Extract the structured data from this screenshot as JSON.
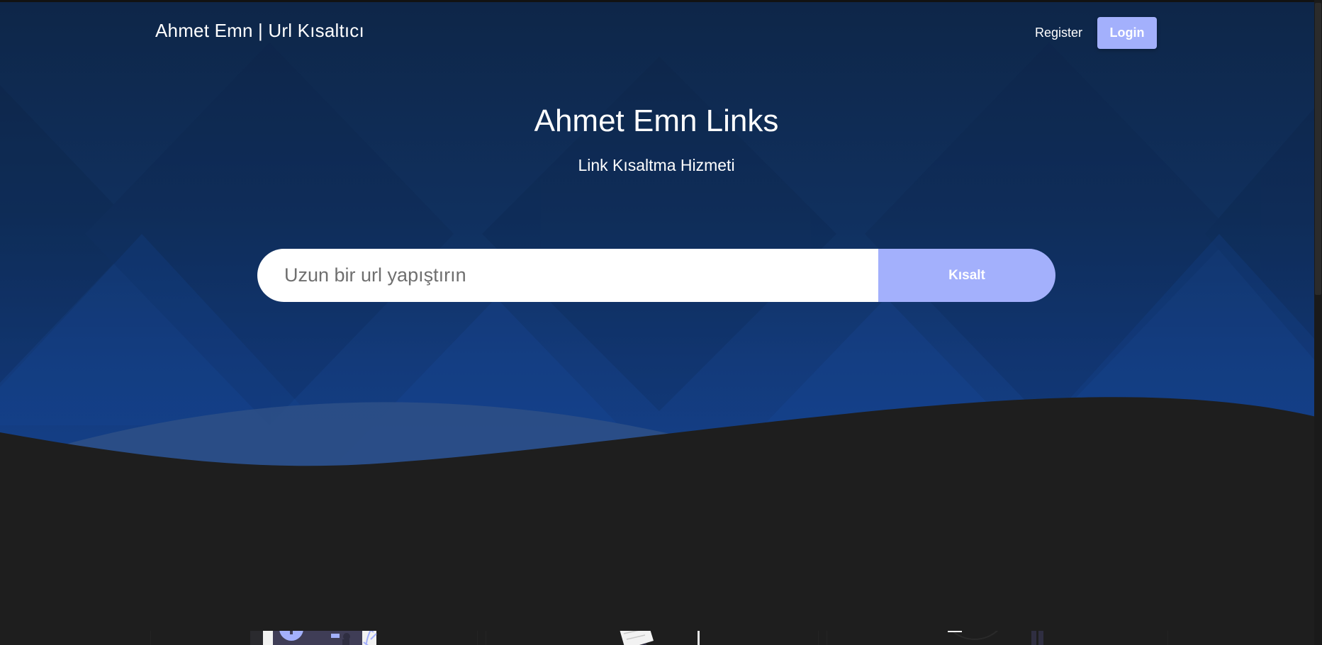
{
  "navbar": {
    "brand": "Ahmet Emn | Url Kısaltıcı",
    "register_label": "Register",
    "login_label": "Login"
  },
  "hero": {
    "title": "Ahmet Emn Links",
    "subtitle": "Link Kısaltma Hizmeti"
  },
  "shorten": {
    "placeholder": "Uzun bir url yapıştırın",
    "button_label": "Kısalt"
  },
  "features": {
    "items": [
      {
        "icon": "secure-lock-illustration-icon"
      },
      {
        "icon": "signpost-directions-illustration-icon"
      },
      {
        "icon": "add-content-illustration-icon"
      }
    ]
  },
  "colors": {
    "accent": "#a3b0fc",
    "hero_dark": "#0e2648",
    "hero_light": "#14408a",
    "page_background": "#1e1e1e"
  }
}
